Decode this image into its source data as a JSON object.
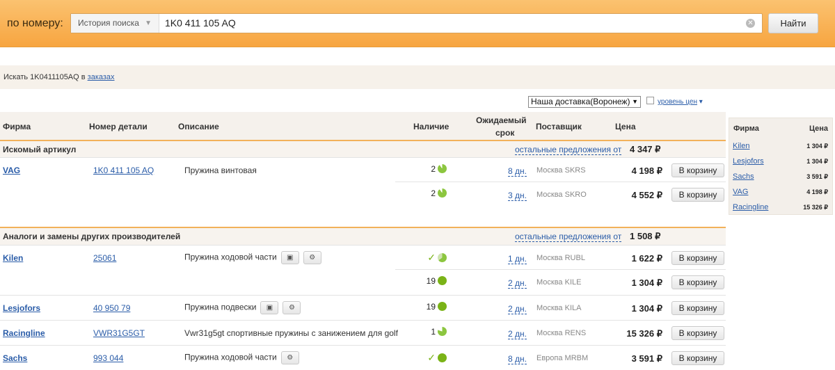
{
  "search": {
    "label": "по номеру:",
    "history_label": "История поиска",
    "query": "1K0 411 105 AQ",
    "find_button": "Найти"
  },
  "orders": {
    "prefix": "Искать 1K0411105AQ в ",
    "link": "заказах"
  },
  "controls": {
    "delivery_selected": "Наша доставка(Воронеж)",
    "price_level_label": "уровень цен"
  },
  "table": {
    "headers": {
      "brand": "Фирма",
      "number": "Номер детали",
      "description": "Описание",
      "availability": "Наличие",
      "expected_line1": "Ожидаемый",
      "expected_line2": "срок",
      "supplier": "Поставщик",
      "price": "Цена"
    },
    "section1": {
      "title": "Искомый артикул",
      "others_link": "остальные предложения от",
      "min_price": "4 347 ₽"
    },
    "section2": {
      "title": "Аналоги и замены других производителей",
      "others_link": "остальные предложения от",
      "min_price": "1 508 ₽"
    },
    "cart_label": "В корзину",
    "rows": [
      {
        "brand": "VAG",
        "number": "1K0 411 105 AQ",
        "description": "Пружина винтовая",
        "availability": "2",
        "days": "8 дн.",
        "supplier": "Москва SKRS",
        "price": "4 198 ₽"
      },
      {
        "brand": "",
        "number": "",
        "description": "",
        "availability": "2",
        "days": "3 дн.",
        "supplier": "Москва SKRO",
        "price": "4 552 ₽"
      },
      {
        "brand": "Kilen",
        "number": "25061",
        "description": "Пружина ходовой части",
        "availability": "",
        "days": "1 дн.",
        "supplier": "Москва RUBL",
        "price": "1 622 ₽"
      },
      {
        "brand": "",
        "number": "",
        "description": "",
        "availability": "19",
        "days": "2 дн.",
        "supplier": "Москва KILE",
        "price": "1 304 ₽"
      },
      {
        "brand": "Lesjofors",
        "number": "40 950 79",
        "description": "Пружина подвески",
        "availability": "19",
        "days": "2 дн.",
        "supplier": "Москва KILA",
        "price": "1 304 ₽"
      },
      {
        "brand": "Racingline",
        "number": "VWR31G5GT",
        "description": "Vwr31g5gt спортивные пружины с занижением для golf",
        "availability": "1",
        "days": "2 дн.",
        "supplier": "Москва RENS",
        "price": "15 326 ₽"
      },
      {
        "brand": "Sachs",
        "number": "993 044",
        "description": "Пружина ходовой части",
        "availability": "",
        "days": "8 дн.",
        "supplier": "Европа MRBM",
        "price": "3 591 ₽"
      }
    ]
  },
  "side_panel": {
    "header_brand": "Фирма",
    "header_price": "Цена",
    "rows": [
      {
        "brand": "Kilen",
        "price": "1 304 ₽"
      },
      {
        "brand": "Lesjofors",
        "price": "1 304 ₽"
      },
      {
        "brand": "Sachs",
        "price": "3 591 ₽"
      },
      {
        "brand": "VAG",
        "price": "4 198 ₽"
      },
      {
        "brand": "Racingline",
        "price": "15 326 ₽"
      }
    ]
  },
  "colors": {
    "accent": "#f7a540",
    "link": "#2a5ca8",
    "availability_green": "#7ab317"
  }
}
